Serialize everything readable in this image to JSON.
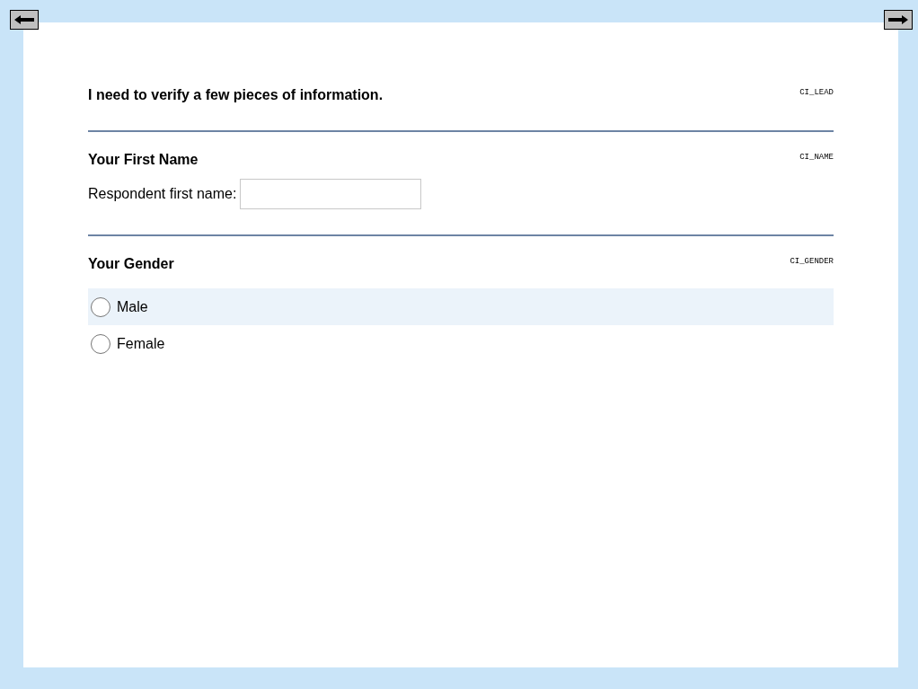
{
  "sections": [
    {
      "kind": "lead",
      "title": "I need to verify a few pieces of information.",
      "code": "CI_LEAD"
    },
    {
      "kind": "text",
      "title": "Your First Name",
      "code": "CI_NAME",
      "label": "Respondent first name:"
    },
    {
      "kind": "radio",
      "title": "Your Gender",
      "code": "CI_GENDER",
      "options": [
        {
          "label": "Male",
          "selected": false,
          "highlighted": true
        },
        {
          "label": "Female",
          "selected": false,
          "highlighted": false
        }
      ]
    }
  ]
}
